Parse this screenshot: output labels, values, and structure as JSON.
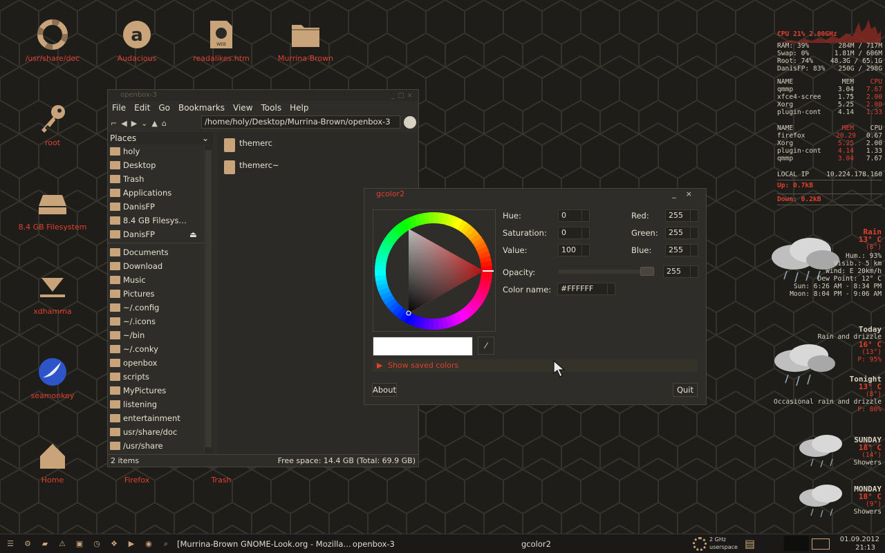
{
  "desktop_icons": [
    {
      "label": "/usr/share/doc",
      "icon": "lifebuoy-icon"
    },
    {
      "label": "Audacious",
      "icon": "audacious-icon"
    },
    {
      "label": "readalikes.htm",
      "icon": "web-file-icon"
    },
    {
      "label": "Murrina-Brown",
      "icon": "folder-icon"
    },
    {
      "label": "root",
      "icon": "key-icon"
    },
    {
      "label": "8.4 GB Filesystem",
      "icon": "drive-icon"
    },
    {
      "label": "xdhamma",
      "icon": "download-icon"
    },
    {
      "label": "seamonkey",
      "icon": "seamonkey-icon"
    },
    {
      "label": "Home",
      "icon": "home-icon"
    },
    {
      "label": "Firefox",
      "icon": "firefox-icon"
    },
    {
      "label": "Trash",
      "icon": "trash-icon"
    }
  ],
  "file_manager": {
    "title": "openbox-3",
    "menu": [
      "File",
      "Edit",
      "Go",
      "Bookmarks",
      "View",
      "Tools",
      "Help"
    ],
    "address": "/home/holy/Desktop/Murrina-Brown/openbox-3",
    "places_label": "Places",
    "places": [
      "holy",
      "Desktop",
      "Trash",
      "Applications",
      "DanisFP",
      "8.4 GB Filesys…",
      "DanisFP"
    ],
    "bookmarks": [
      "Documents",
      "Download",
      "Music",
      "Pictures",
      "~/.config",
      "~/.icons",
      "~/bin",
      "~/.conky",
      "openbox",
      "scripts",
      "MyPictures",
      "listening",
      "entertainment",
      "usr/share/doc",
      "/usr/share"
    ],
    "files": [
      "themerc",
      "themerc~"
    ],
    "status_left": "2 items",
    "status_right": "Free space: 14.4 GB (Total: 69.9 GB)"
  },
  "gcolor": {
    "title": "gcolor2",
    "hue_label": "Hue:",
    "hue": "0",
    "sat_label": "Saturation:",
    "sat": "0",
    "val_label": "Value:",
    "val": "100",
    "red_label": "Red:",
    "red": "255",
    "green_label": "Green:",
    "green": "255",
    "blue_label": "Blue:",
    "blue": "255",
    "opacity_label": "Opacity:",
    "opacity": "255",
    "colorname_label": "Color name:",
    "colorname": "#FFFFFF",
    "saved_colors": "Show saved colors",
    "about": "About",
    "quit": "Quit",
    "swatch_color": "#ffffff"
  },
  "conky": {
    "cpu": "CPU 21%  2.00GHz",
    "stats": [
      {
        "l": "RAM: 39%",
        "r": "284M / 717M"
      },
      {
        "l": "Swap: 0%",
        "r": "1.81M / 606M"
      },
      {
        "l": "Root: 74%",
        "r": "48.3G / 65.1G"
      },
      {
        "l": "DanisFP: 83%",
        "r": "250G / 298G"
      }
    ],
    "table1_header": [
      "NAME",
      "MEM",
      "CPU"
    ],
    "table1": [
      [
        "qmmp",
        "3.04",
        "7.67"
      ],
      [
        "xfce4-scree",
        "1.75",
        "2.00"
      ],
      [
        "Xorg",
        "5.25",
        "2.00"
      ],
      [
        "plugin-cont",
        "4.14",
        "1.33"
      ]
    ],
    "table2_header": [
      "NAME",
      "MEM",
      "CPU"
    ],
    "table2": [
      [
        "firefox",
        "20.29",
        "0.67"
      ],
      [
        "Xorg",
        "5.25",
        "2.00"
      ],
      [
        "plugin-cont",
        "4.14",
        "1.33"
      ],
      [
        "qmmp",
        "3.04",
        "7.67"
      ]
    ],
    "local_ip_label": "LOCAL IP",
    "local_ip": "10.224.178.160",
    "up": "Up: 0.7kB",
    "down": "Down: 0.2kB"
  },
  "weather": {
    "now_cond": "Rain",
    "now_temp": "13° C",
    "now_feels": "(8°)",
    "hum": "Hum.: 93%",
    "visib": "Visib.: 5 km",
    "wind": "Wind: E 20km/h",
    "dew": "Dew Point: 12° C",
    "sun": "Sun: 6:26 AM - 8:34 PM",
    "moon": "Moon: 8:04 PM - 9:06 AM",
    "today_label": "Today",
    "today_cond": "Rain and drizzle",
    "today_temp": "16° C",
    "today_feels": "(13°)",
    "today_p": "P: 95%",
    "tonight_label": "Tonight",
    "tonight_temp": "13° C",
    "tonight_feels": "(8°)",
    "tonight_cond": "Occasional rain and drizzle",
    "tonight_p": "P: 80%",
    "sun_label": "SUNDAY",
    "sun_temp": "18° C",
    "sun_feels": "(14°)",
    "sun_cond": "Showers",
    "mon_label": "MONDAY",
    "mon_temp": "18° C",
    "mon_feels": "(9°)",
    "mon_cond": "Showers"
  },
  "panel": {
    "task1": "[Murrina-Brown GNOME-Look.org - Mozilla…",
    "task2": "openbox-3",
    "task3": "gcolor2",
    "cpu_freq": "2 GHz",
    "governor": "userspace",
    "date": "01.09.2012",
    "time": "21:13"
  }
}
